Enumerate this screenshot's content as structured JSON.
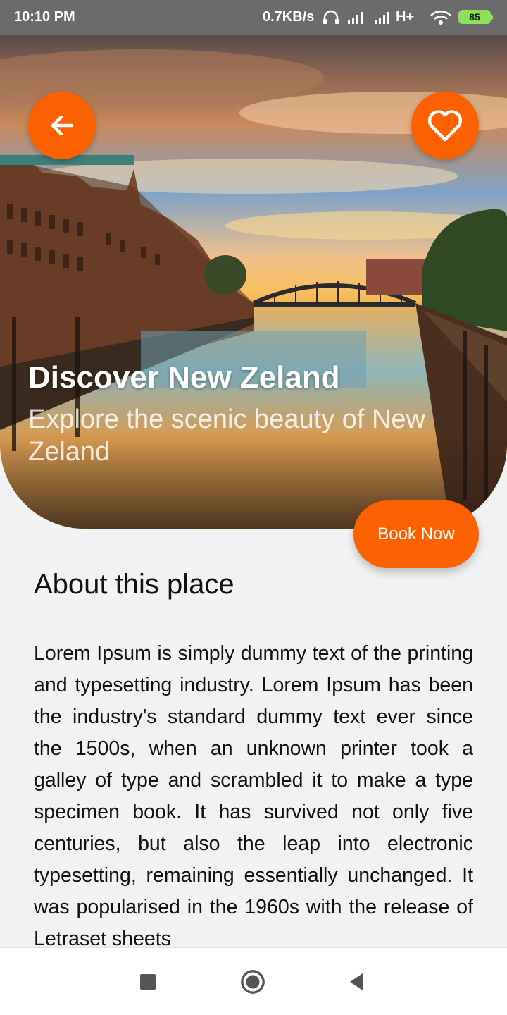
{
  "status_bar": {
    "time": "10:10 PM",
    "network_speed": "0.7KB/s",
    "network_type": "H+",
    "battery": "85",
    "icons": [
      "headphones-icon",
      "signal-icon",
      "signal-icon",
      "wifi-icon",
      "battery-icon"
    ]
  },
  "hero": {
    "title": "Discover New Zeland",
    "subtitle": "Explore the scenic beauty of New Zeland",
    "back_icon": "arrow-left-icon",
    "favorite_icon": "heart-outline-icon"
  },
  "book_button": {
    "label": "Book Now"
  },
  "about": {
    "heading": "About this place",
    "body": "Lorem Ipsum is simply dummy text of the printing and typesetting industry. Lorem Ipsum has been the industry's standard dummy text ever since the 1500s, when an unknown printer took a galley of type and scrambled it to make a type specimen book. It has survived not only five centuries, but also the leap into electronic typesetting, remaining essentially unchanged. It was popularised in the 1960s with the release of Letraset sheets"
  },
  "nav_bar": {
    "icons": [
      "recent-apps-icon",
      "home-icon",
      "back-icon"
    ]
  },
  "colors": {
    "accent": "#fb6100",
    "status_bar": "#6b6b6b",
    "background": "#f2f2f2"
  }
}
